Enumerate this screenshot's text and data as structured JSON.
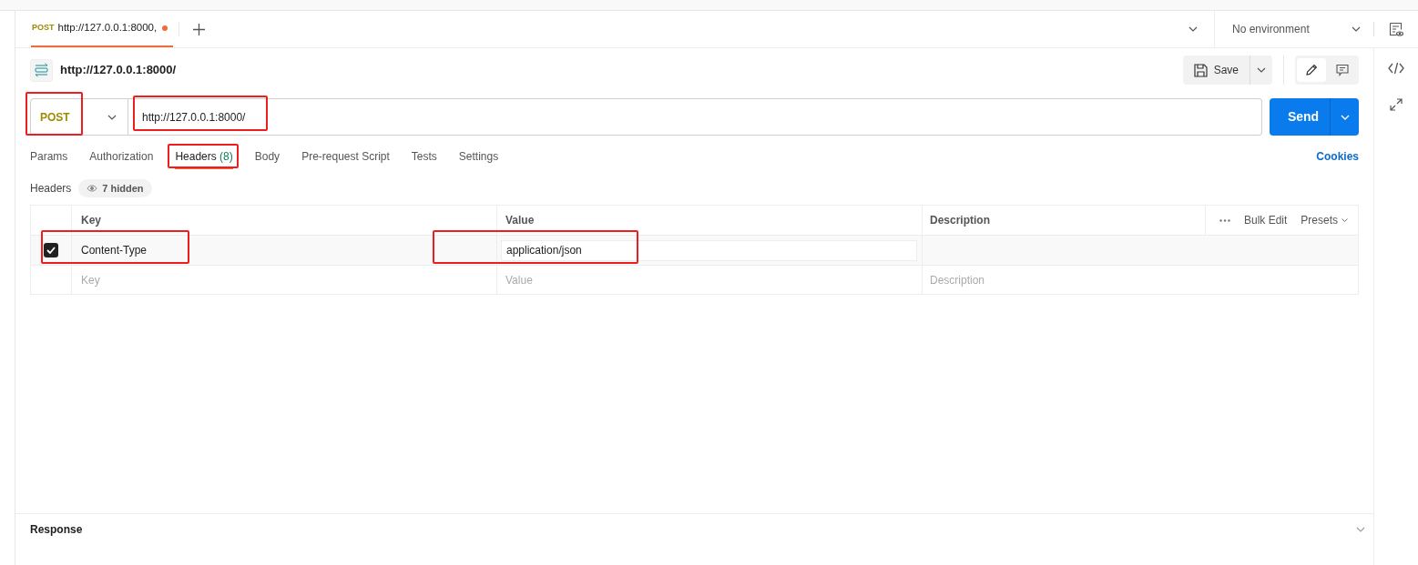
{
  "tab": {
    "method": "POST",
    "title": "http://127.0.0.1:8000,",
    "unsaved": true,
    "selected": true
  },
  "environment": {
    "label": "No environment"
  },
  "request": {
    "title": "http://127.0.0.1:8000/",
    "method": {
      "label": "POST",
      "highlighted": true
    },
    "url": {
      "value": "http://127.0.0.1:8000/",
      "highlighted": true
    },
    "save_label": "Save",
    "send_label": "Send",
    "mode_toggle": [
      {
        "kind": "edit",
        "selected": true
      },
      {
        "kind": "comment",
        "selected": false
      }
    ]
  },
  "tabs": [
    {
      "label": "Params",
      "selected": false,
      "highlighted": false
    },
    {
      "label": "Authorization",
      "selected": false,
      "highlighted": false
    },
    {
      "label": "Headers",
      "count": "(8)",
      "selected": true,
      "highlighted": true
    },
    {
      "label": "Body",
      "selected": false,
      "highlighted": false
    },
    {
      "label": "Pre-request Script",
      "selected": false,
      "highlighted": false
    },
    {
      "label": "Tests",
      "selected": false,
      "highlighted": false
    },
    {
      "label": "Settings",
      "selected": false,
      "highlighted": false
    }
  ],
  "cookies_link": "Cookies",
  "headers": {
    "title": "Headers",
    "hidden_badge": "7 hidden",
    "columns": [
      "Key",
      "Value",
      "Description"
    ],
    "actions": [
      "Bulk Edit",
      "Presets"
    ],
    "rows": [
      {
        "checked": true,
        "key": "Content-Type",
        "value": "application/json",
        "key_highlighted": true,
        "value_highlighted": true
      }
    ],
    "empty_row": [
      {
        "placeholder": "Key"
      },
      {
        "placeholder": "Value"
      },
      {
        "placeholder": "Description"
      }
    ]
  },
  "response": {
    "title": "Response"
  }
}
